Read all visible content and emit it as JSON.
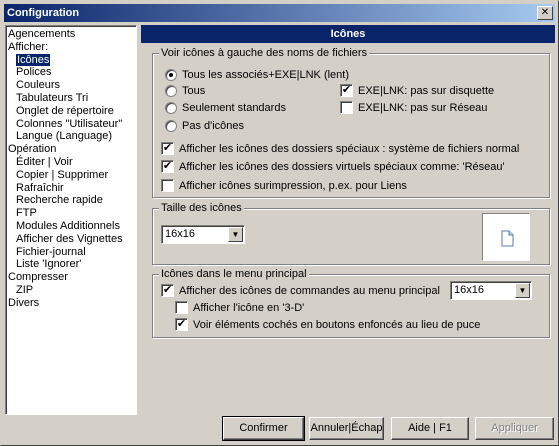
{
  "window": {
    "title": "Configuration"
  },
  "tree": {
    "items": [
      {
        "label": "Agencements",
        "level": 0,
        "selected": false
      },
      {
        "label": "Afficher:",
        "level": 0,
        "selected": false
      },
      {
        "label": "Icônes",
        "level": 1,
        "selected": true
      },
      {
        "label": "Polices",
        "level": 1,
        "selected": false
      },
      {
        "label": "Couleurs",
        "level": 1,
        "selected": false
      },
      {
        "label": "Tabulateurs Tri",
        "level": 1,
        "selected": false
      },
      {
        "label": "Onglet de répertoire",
        "level": 1,
        "selected": false
      },
      {
        "label": "Colonnes \"Utilisateur\"",
        "level": 1,
        "selected": false
      },
      {
        "label": "Langue (Language)",
        "level": 1,
        "selected": false
      },
      {
        "label": "Opération",
        "level": 0,
        "selected": false
      },
      {
        "label": "Éditer | Voir",
        "level": 1,
        "selected": false
      },
      {
        "label": "Copier | Supprimer",
        "level": 1,
        "selected": false
      },
      {
        "label": "Rafraîchir",
        "level": 1,
        "selected": false
      },
      {
        "label": "Recherche rapide",
        "level": 1,
        "selected": false
      },
      {
        "label": "FTP",
        "level": 1,
        "selected": false
      },
      {
        "label": "Modules Additionnels",
        "level": 1,
        "selected": false
      },
      {
        "label": "Afficher des Vignettes",
        "level": 1,
        "selected": false
      },
      {
        "label": "Fichier-journal",
        "level": 1,
        "selected": false
      },
      {
        "label": "Liste 'Ignorer'",
        "level": 1,
        "selected": false
      },
      {
        "label": "Compresser",
        "level": 0,
        "selected": false
      },
      {
        "label": "ZIP",
        "level": 1,
        "selected": false
      },
      {
        "label": "Divers",
        "level": 0,
        "selected": false
      }
    ]
  },
  "panel": {
    "title": "Icônes"
  },
  "group_show": {
    "title": "Voir icônes à gauche des noms de fichiers",
    "radio_all": "Tous les associés+EXE|LNK (lent)",
    "radio_tous": "Tous",
    "radio_standard": "Seulement standards",
    "radio_none": "Pas d'icônes",
    "check_exe_floppy": "EXE|LNK: pas sur disquette",
    "check_exe_network": "EXE|LNK: pas sur Réseau",
    "check_special_folders": "Afficher les icônes des dossiers spéciaux : système de fichiers normal",
    "check_virtual_folders": "Afficher les icônes des dossiers virtuels spéciaux comme: 'Réseau'",
    "check_overlay": "Afficher icônes surimpression, p.ex. pour Liens"
  },
  "group_size": {
    "title": "Taille des icônes",
    "value": "16x16"
  },
  "group_menu": {
    "title": "Icônes dans le menu principal",
    "check_show_cmd_icons": "Afficher des icônes de commandes au menu principal",
    "size_value": "16x16",
    "check_3d": "Afficher l'icône en '3-D'",
    "check_pressed": "Voir éléments cochés en boutons enfoncés au lieu de puce"
  },
  "buttons": {
    "ok": "Confirmer",
    "cancel": "Annuler|Échap",
    "help": "Aide | F1",
    "apply": "Appliquer"
  }
}
